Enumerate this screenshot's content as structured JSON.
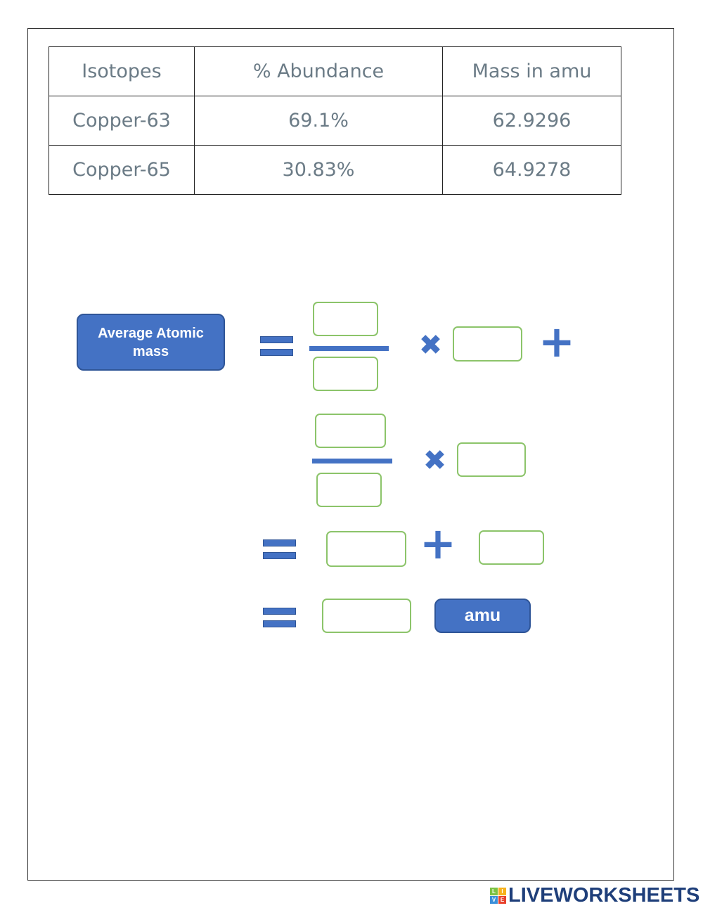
{
  "table": {
    "headers": [
      "Isotopes",
      "% Abundance",
      "Mass in amu"
    ],
    "rows": [
      [
        "Copper-63",
        "69.1%",
        "62.9296"
      ],
      [
        "Copper-65",
        "30.83%",
        "64.9278"
      ]
    ]
  },
  "equation": {
    "label": "Average Atomic mass",
    "unit": "amu",
    "equals": "=",
    "times": "✖",
    "plus": "+"
  },
  "colors": {
    "accent": "#4472c4",
    "input_border": "#8cc46a",
    "text": "#6b7b86"
  },
  "logo": {
    "text": "LIVEWORKSHEETS",
    "letters": [
      "L",
      "I",
      "V",
      "E"
    ]
  }
}
